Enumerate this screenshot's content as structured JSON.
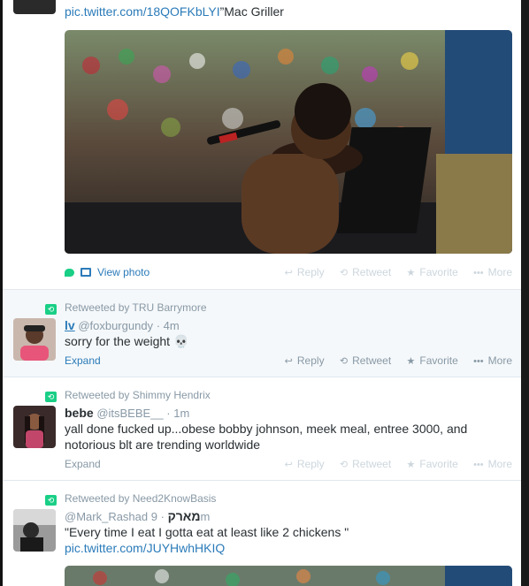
{
  "tweets": [
    {
      "link_text": "pic.twitter.com/18QOFKbLYI",
      "after_link": "”Mac Griller",
      "view_photo_label": "View photo",
      "actions": {
        "reply": "Reply",
        "retweet": "Retweet",
        "favorite": "Favorite",
        "more": "More"
      }
    },
    {
      "retweeted_by": "Retweeted by TRU Barrymore",
      "fullname": "lv",
      "username": "@foxburgundy",
      "dot": "·",
      "time": "4m",
      "text": "sorry for the weight 💀",
      "expand": "Expand",
      "actions": {
        "reply": "Reply",
        "retweet": "Retweet",
        "favorite": "Favorite",
        "more": "More"
      }
    },
    {
      "retweeted_by": "Retweeted by Shimmy Hendrix",
      "fullname": "bebe",
      "username": "@itsBEBE__",
      "dot": "·",
      "time": "1m",
      "text": "yall done fucked up...obese bobby johnson, meek meal, entree 3000, and notorious blt are trending worldwide",
      "expand": "Expand",
      "actions": {
        "reply": "Reply",
        "retweet": "Retweet",
        "favorite": "Favorite",
        "more": "More"
      }
    },
    {
      "retweeted_by": "Retweeted by Need2KnowBasis",
      "username": "@Mark_Rashad",
      "fullname": "מארק",
      "dot": "·",
      "time": "9m",
      "text": "\"Every time I eat I gotta eat at least like 2 chickens \"",
      "link_text": "pic.twitter.com/JUYHwhHKIQ"
    }
  ],
  "colors": {
    "link": "#2b7bb9",
    "retweet_green": "#19cf86",
    "meta_gray": "#8899a6"
  }
}
